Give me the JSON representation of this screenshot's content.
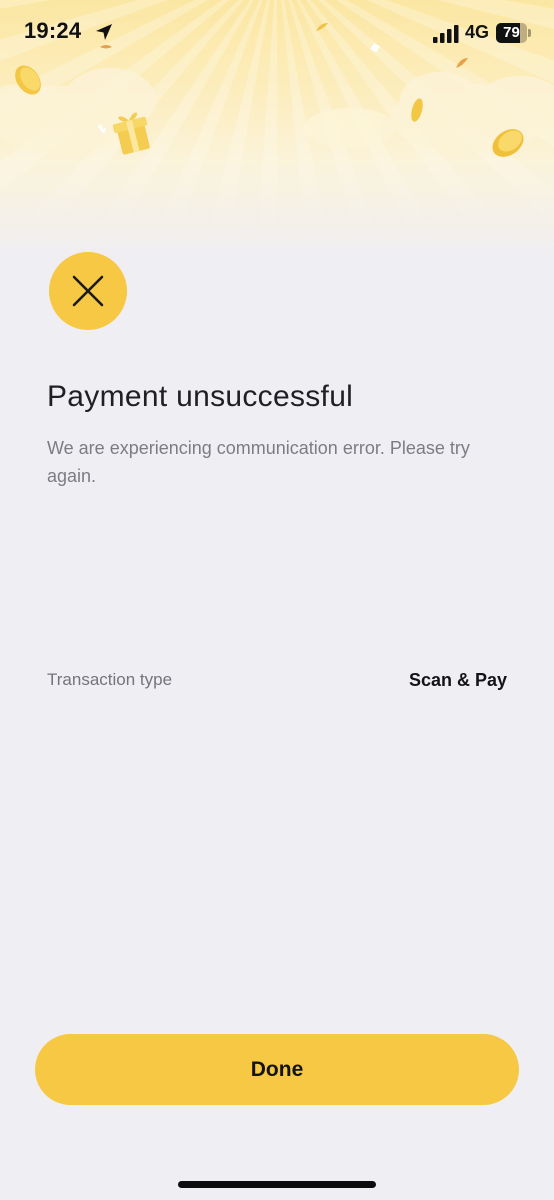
{
  "status_bar": {
    "time": "19:24",
    "network": "4G",
    "battery_percent": "79",
    "battery_level": 0.79,
    "icons": [
      "location-arrow-icon",
      "cellular-signal-icon",
      "battery-icon"
    ]
  },
  "header": {
    "decorations": [
      "coin-icon",
      "gift-box-icon",
      "confetti-icon",
      "cloud-icon"
    ]
  },
  "result": {
    "icon": "close-icon",
    "title": "Payment unsuccessful",
    "message": "We are experiencing communication error. Please try again."
  },
  "details": {
    "rows": [
      {
        "label": "Transaction type",
        "value": "Scan & Pay"
      }
    ]
  },
  "actions": {
    "done_label": "Done"
  },
  "colors": {
    "accent": "#f6c843",
    "background": "#efeef3",
    "title_text": "#1f1f24",
    "muted_text": "#7c7c84"
  }
}
